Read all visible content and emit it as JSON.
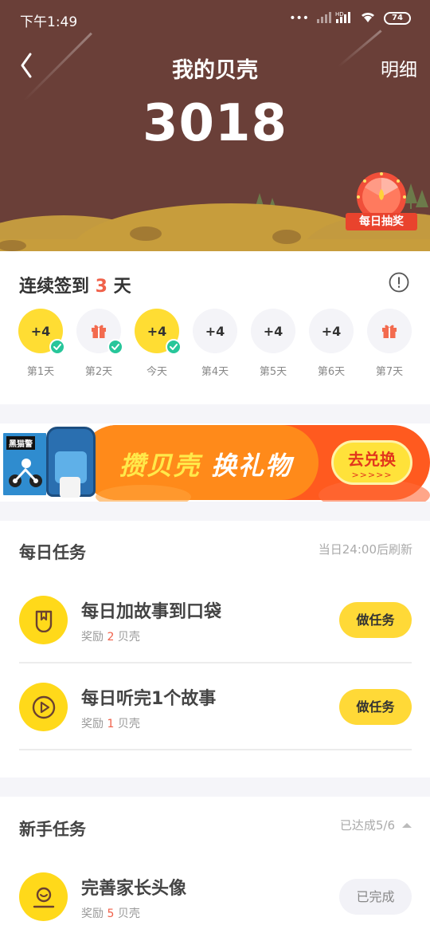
{
  "status": {
    "time": "下午1:49",
    "icons": "••• ",
    "signal": "HD",
    "battery": "74"
  },
  "header": {
    "title": "我的贝壳",
    "detail": "明细",
    "score": "3018",
    "lottery_label": "每日抽奖"
  },
  "checkin": {
    "title_prefix": "连续签到 ",
    "days": "3",
    "title_suffix": " 天",
    "items": [
      {
        "value": "+4",
        "label": "第1天",
        "type": "points",
        "done": true
      },
      {
        "value": "",
        "label": "第2天",
        "type": "gift",
        "done": true
      },
      {
        "value": "+4",
        "label": "今天",
        "type": "points",
        "done": true
      },
      {
        "value": "+4",
        "label": "第4天",
        "type": "points",
        "done": false
      },
      {
        "value": "+4",
        "label": "第5天",
        "type": "points",
        "done": false
      },
      {
        "value": "+4",
        "label": "第6天",
        "type": "points",
        "done": false
      },
      {
        "value": "",
        "label": "第7天",
        "type": "gift",
        "done": false
      }
    ]
  },
  "banner": {
    "text1": "攒贝壳",
    "text2": "换礼物",
    "button": "去兑换",
    "arrows": ">>>>>",
    "book_label": "黑猫警"
  },
  "daily": {
    "title": "每日任务",
    "note": "当日24:00后刷新",
    "tasks": [
      {
        "name": "每日加故事到口袋",
        "reward_prefix": "奖励 ",
        "reward": "2",
        "reward_suffix": " 贝壳",
        "button": "做任务",
        "icon": "pocket-icon"
      },
      {
        "name": "每日听完1个故事",
        "reward_prefix": "奖励 ",
        "reward": "1",
        "reward_suffix": " 贝壳",
        "button": "做任务",
        "icon": "play-icon"
      }
    ]
  },
  "newbie": {
    "title": "新手任务",
    "note": "已达成5/6",
    "tasks": [
      {
        "name": "完善家长头像",
        "reward_prefix": "奖励 ",
        "reward": "5",
        "reward_suffix": " 贝壳",
        "button": "已完成",
        "icon": "avatar-icon"
      }
    ]
  },
  "colors": {
    "header": "#6a3f38",
    "accent": "#ffd937",
    "red": "#f0614a",
    "green": "#27c69a"
  }
}
